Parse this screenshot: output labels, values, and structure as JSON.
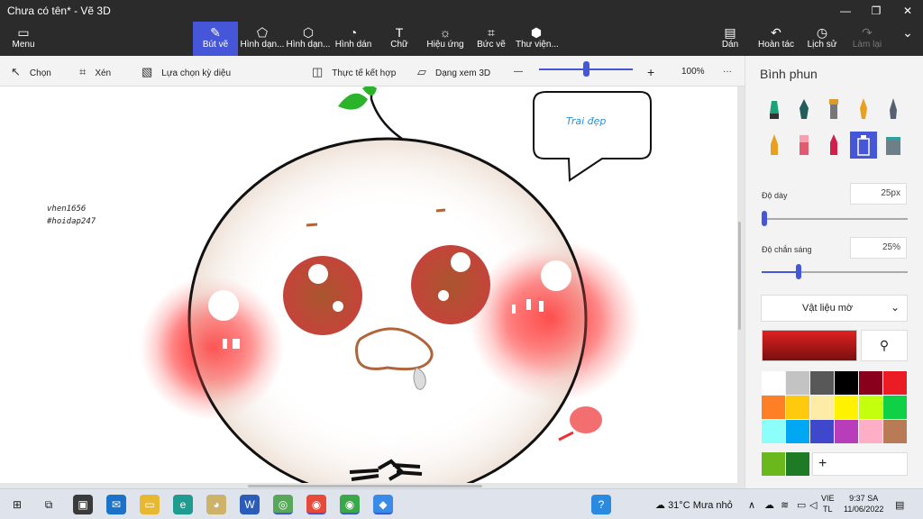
{
  "window": {
    "title": "Chưa có tên* - Vẽ 3D"
  },
  "ribbon": {
    "menu_label": "Menu",
    "tools": [
      {
        "label": "Bút vẽ"
      },
      {
        "label": "Hình dạn..."
      },
      {
        "label": "Hình dạn..."
      },
      {
        "label": "Hình dán"
      },
      {
        "label": "Chữ"
      },
      {
        "label": "Hiệu ứng"
      },
      {
        "label": "Bức vẽ"
      },
      {
        "label": "Thư viện..."
      }
    ],
    "right": [
      {
        "label": "Dán"
      },
      {
        "label": "Hoàn tác"
      },
      {
        "label": "Lịch sử"
      },
      {
        "label": "Làm lại"
      }
    ]
  },
  "toolbar": {
    "select": "Chọn",
    "crop": "Xén",
    "magic_select": "Lựa chọn kỳ diệu",
    "mixed_reality": "Thực tế kết hợp",
    "view_3d": "Dạng xem 3D",
    "zoom_minus": "—",
    "zoom_plus": "+",
    "zoom_level": "100%",
    "more": "···",
    "zoom_fraction": 0.5
  },
  "canvas": {
    "watermark_line1": "vhen1656",
    "watermark_line2": "#hoidap247",
    "bubble_text": "Trai đẹp"
  },
  "panel": {
    "title": "Bình phun",
    "thickness_label": "Độ dày",
    "thickness_value": "25px",
    "thickness_fraction": 0.02,
    "opacity_label": "Độ chắn sáng",
    "opacity_value": "25%",
    "opacity_fraction": 0.25,
    "material": "Vật liệu mờ",
    "current_color": "#e02020",
    "add_color": "+",
    "palette": [
      "#ffffff",
      "#c3c3c3",
      "#585858",
      "#000000",
      "#88001b",
      "#ec1c24",
      "#ff7f27",
      "#ffc90e",
      "#fdeca6",
      "#fff200",
      "#c4ff0e",
      "#0ed145",
      "#8cfffb",
      "#00a8f3",
      "#3f48cc",
      "#b83dba",
      "#ffaec8",
      "#b97a56"
    ],
    "custom_colors": [
      "#6ab81c",
      "#1e7a24"
    ]
  },
  "taskbar": {
    "weather_temp": "31°C",
    "weather_text": "Mưa nhỏ",
    "lang_line1": "VIE",
    "lang_line2": "TL",
    "time": "9:37 SA",
    "date": "11/06/2022",
    "apps": [
      "windows-start",
      "task-view",
      "zoom",
      "mail",
      "file-explorer",
      "edge",
      "paint-palette",
      "word",
      "stock",
      "chrome",
      "chrome-2",
      "paint-3d"
    ]
  }
}
